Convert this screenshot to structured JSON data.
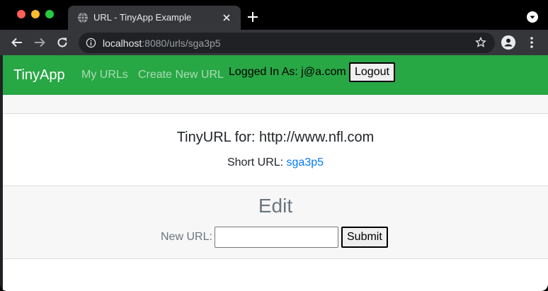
{
  "browser": {
    "tab_title": "URL - TinyApp Example",
    "url_host": "localhost",
    "url_rest": ":8080/urls/sga3p5",
    "icons": {
      "favicon": "globe-icon",
      "close": "close-icon",
      "new_tab": "plus-icon",
      "tab_search": "chevron-down-icon",
      "back": "arrow-left-icon",
      "forward": "arrow-right-icon",
      "reload": "reload-icon",
      "site_info": "info-icon",
      "bookmark": "star-icon",
      "profile": "profile-icon",
      "menu": "kebab-menu-icon"
    }
  },
  "navbar": {
    "brand": "TinyApp",
    "my_urls": "My URLs",
    "create_new": "Create New URL",
    "logged_in": "Logged In As: j@a.com",
    "logout": "Logout"
  },
  "card": {
    "title": "TinyURL for: http://www.nfl.com",
    "short_label": "Short URL: ",
    "short_id": "sga3p5"
  },
  "edit": {
    "title": "Edit",
    "label": "New URL:",
    "input_value": "",
    "submit": "Submit"
  },
  "colors": {
    "navbar": "#28a745",
    "link": "#007bff",
    "muted": "#6c757d"
  }
}
